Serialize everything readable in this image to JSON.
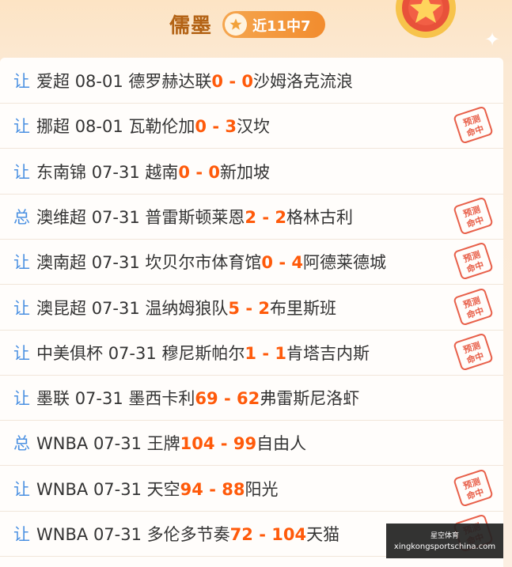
{
  "header": {
    "title": "儒墨",
    "badge": "近11中7"
  },
  "rows": [
    {
      "tag": "让",
      "league": "爱超",
      "date": "08-01",
      "home": "德罗赫达联",
      "home_score": "0",
      "away_score": "0",
      "away": "沙姆洛克流浪",
      "hit": false
    },
    {
      "tag": "让",
      "league": "挪超",
      "date": "08-01",
      "home": "瓦勒伦加",
      "home_score": "0",
      "away_score": "3",
      "away": "汉坎",
      "hit": true
    },
    {
      "tag": "让",
      "league": "东南锦",
      "date": "07-31",
      "home": "越南",
      "home_score": "0",
      "away_score": "0",
      "away": "新加坡",
      "hit": false
    },
    {
      "tag": "总",
      "league": "澳维超",
      "date": "07-31",
      "home": "普雷斯顿莱恩",
      "home_score": "2",
      "away_score": "2",
      "away": "格林古利",
      "hit": true
    },
    {
      "tag": "让",
      "league": "澳南超",
      "date": "07-31",
      "home": "坎贝尔市体育馆",
      "home_score": "0",
      "away_score": "4",
      "away": "阿德莱德城",
      "hit": true
    },
    {
      "tag": "让",
      "league": "澳昆超",
      "date": "07-31",
      "home": "温纳姆狼队",
      "home_score": "5",
      "away_score": "2",
      "away": "布里斯班",
      "hit": true
    },
    {
      "tag": "让",
      "league": "中美俱杯",
      "date": "07-31",
      "home": "穆尼斯帕尔",
      "home_score": "1",
      "away_score": "1",
      "away": "肯塔吉内斯",
      "hit": true
    },
    {
      "tag": "让",
      "league": "墨联",
      "date": "07-31",
      "home": "墨西卡利",
      "home_score": "69",
      "away_score": "62",
      "away": "弗雷斯尼洛虾",
      "hit": false
    },
    {
      "tag": "总",
      "league": "WNBA",
      "date": "07-31",
      "home": "王牌",
      "home_score": "104",
      "away_score": "99",
      "away": "自由人",
      "hit": false
    },
    {
      "tag": "让",
      "league": "WNBA",
      "date": "07-31",
      "home": "天空",
      "home_score": "94",
      "away_score": "88",
      "away": "阳光",
      "hit": true
    },
    {
      "tag": "让",
      "league": "WNBA",
      "date": "07-31",
      "home": "多伦多节奏",
      "home_score": "72",
      "away_score": "104",
      "away": "天猫",
      "hit": true
    }
  ],
  "stamp_text": [
    "预测",
    "命中"
  ],
  "watermark": {
    "line1": "星空体育",
    "line2": "xingkongsportschina.com"
  },
  "colors": {
    "tag": "#4a90e2",
    "score": "#ff5a0a",
    "title": "#b36315",
    "stamp": "#e8604a"
  }
}
